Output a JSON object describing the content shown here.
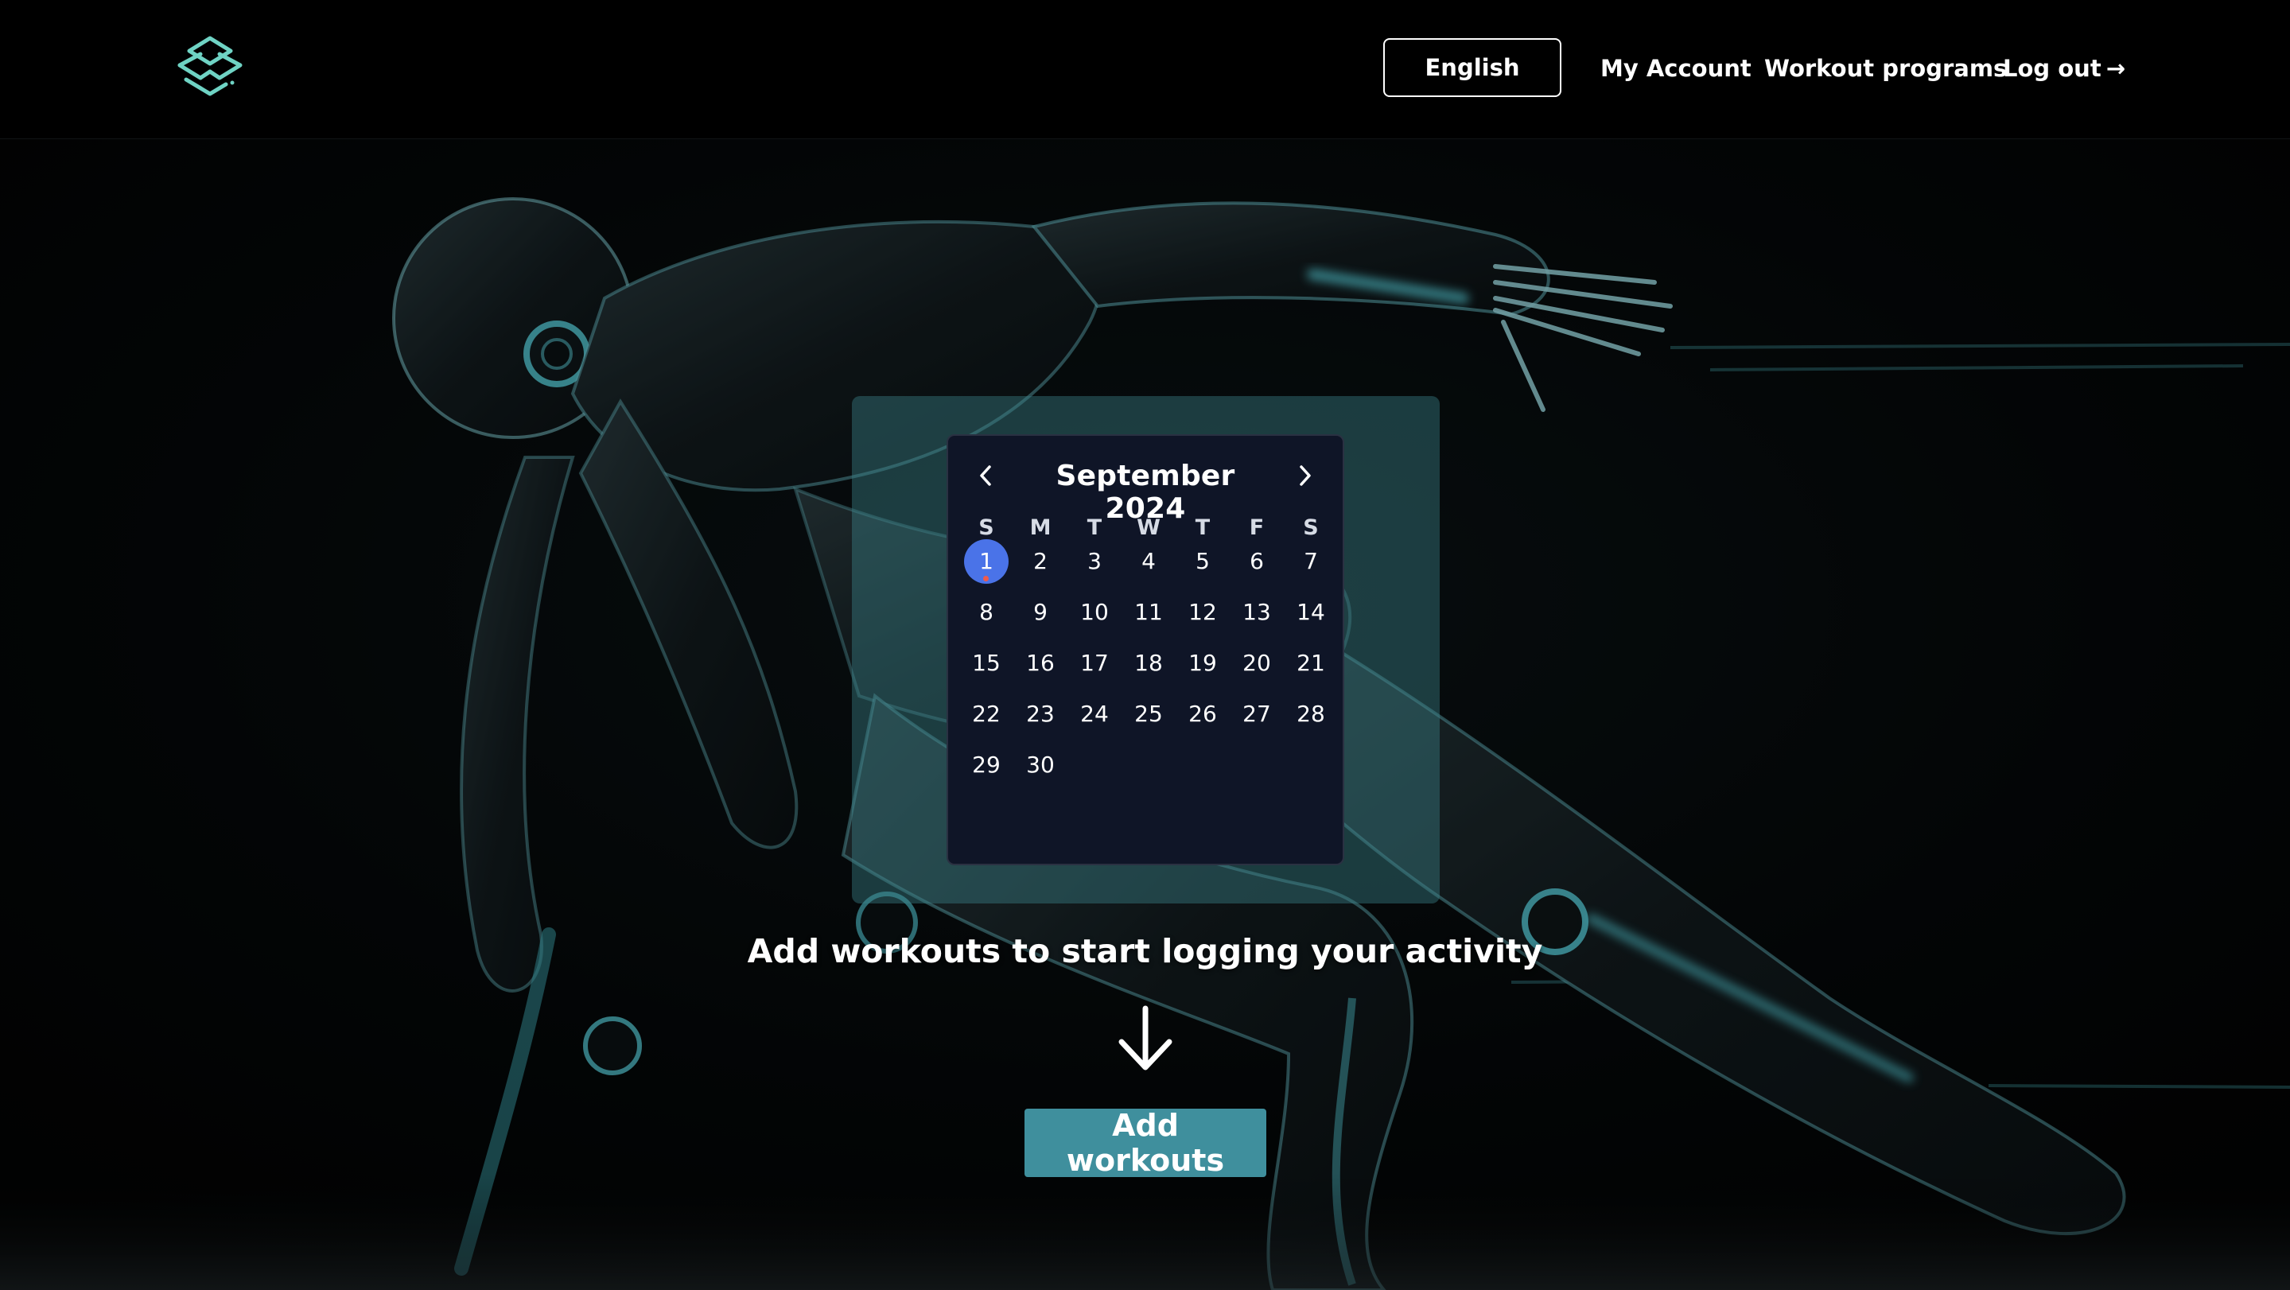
{
  "header": {
    "language_button": "English",
    "nav": {
      "my_account": "My Account",
      "workout_programs": "Workout programs",
      "log_out": "Log out",
      "log_out_arrow": "→"
    }
  },
  "calendar": {
    "month_label": "September 2024",
    "weekdays": [
      "S",
      "M",
      "T",
      "W",
      "T",
      "F",
      "S"
    ],
    "days": [
      "1",
      "2",
      "3",
      "4",
      "5",
      "6",
      "7",
      "8",
      "9",
      "10",
      "11",
      "12",
      "13",
      "14",
      "15",
      "16",
      "17",
      "18",
      "19",
      "20",
      "21",
      "22",
      "23",
      "24",
      "25",
      "26",
      "27",
      "28",
      "29",
      "30"
    ],
    "selected_day": "1",
    "first_weekday_index": 0
  },
  "main": {
    "prompt": "Add workouts to start logging your activity",
    "add_button": "Add workouts"
  },
  "colors": {
    "accent": "#3f8f9d",
    "selected_day": "#4a73e8",
    "today_dot": "#f05a4b",
    "logo": "#6fd3c4"
  },
  "icons": {
    "logo": "stacked-diamond-logo-icon",
    "prev": "chevron-left-icon",
    "next": "chevron-right-icon",
    "cta_arrow": "arrow-down-icon"
  }
}
